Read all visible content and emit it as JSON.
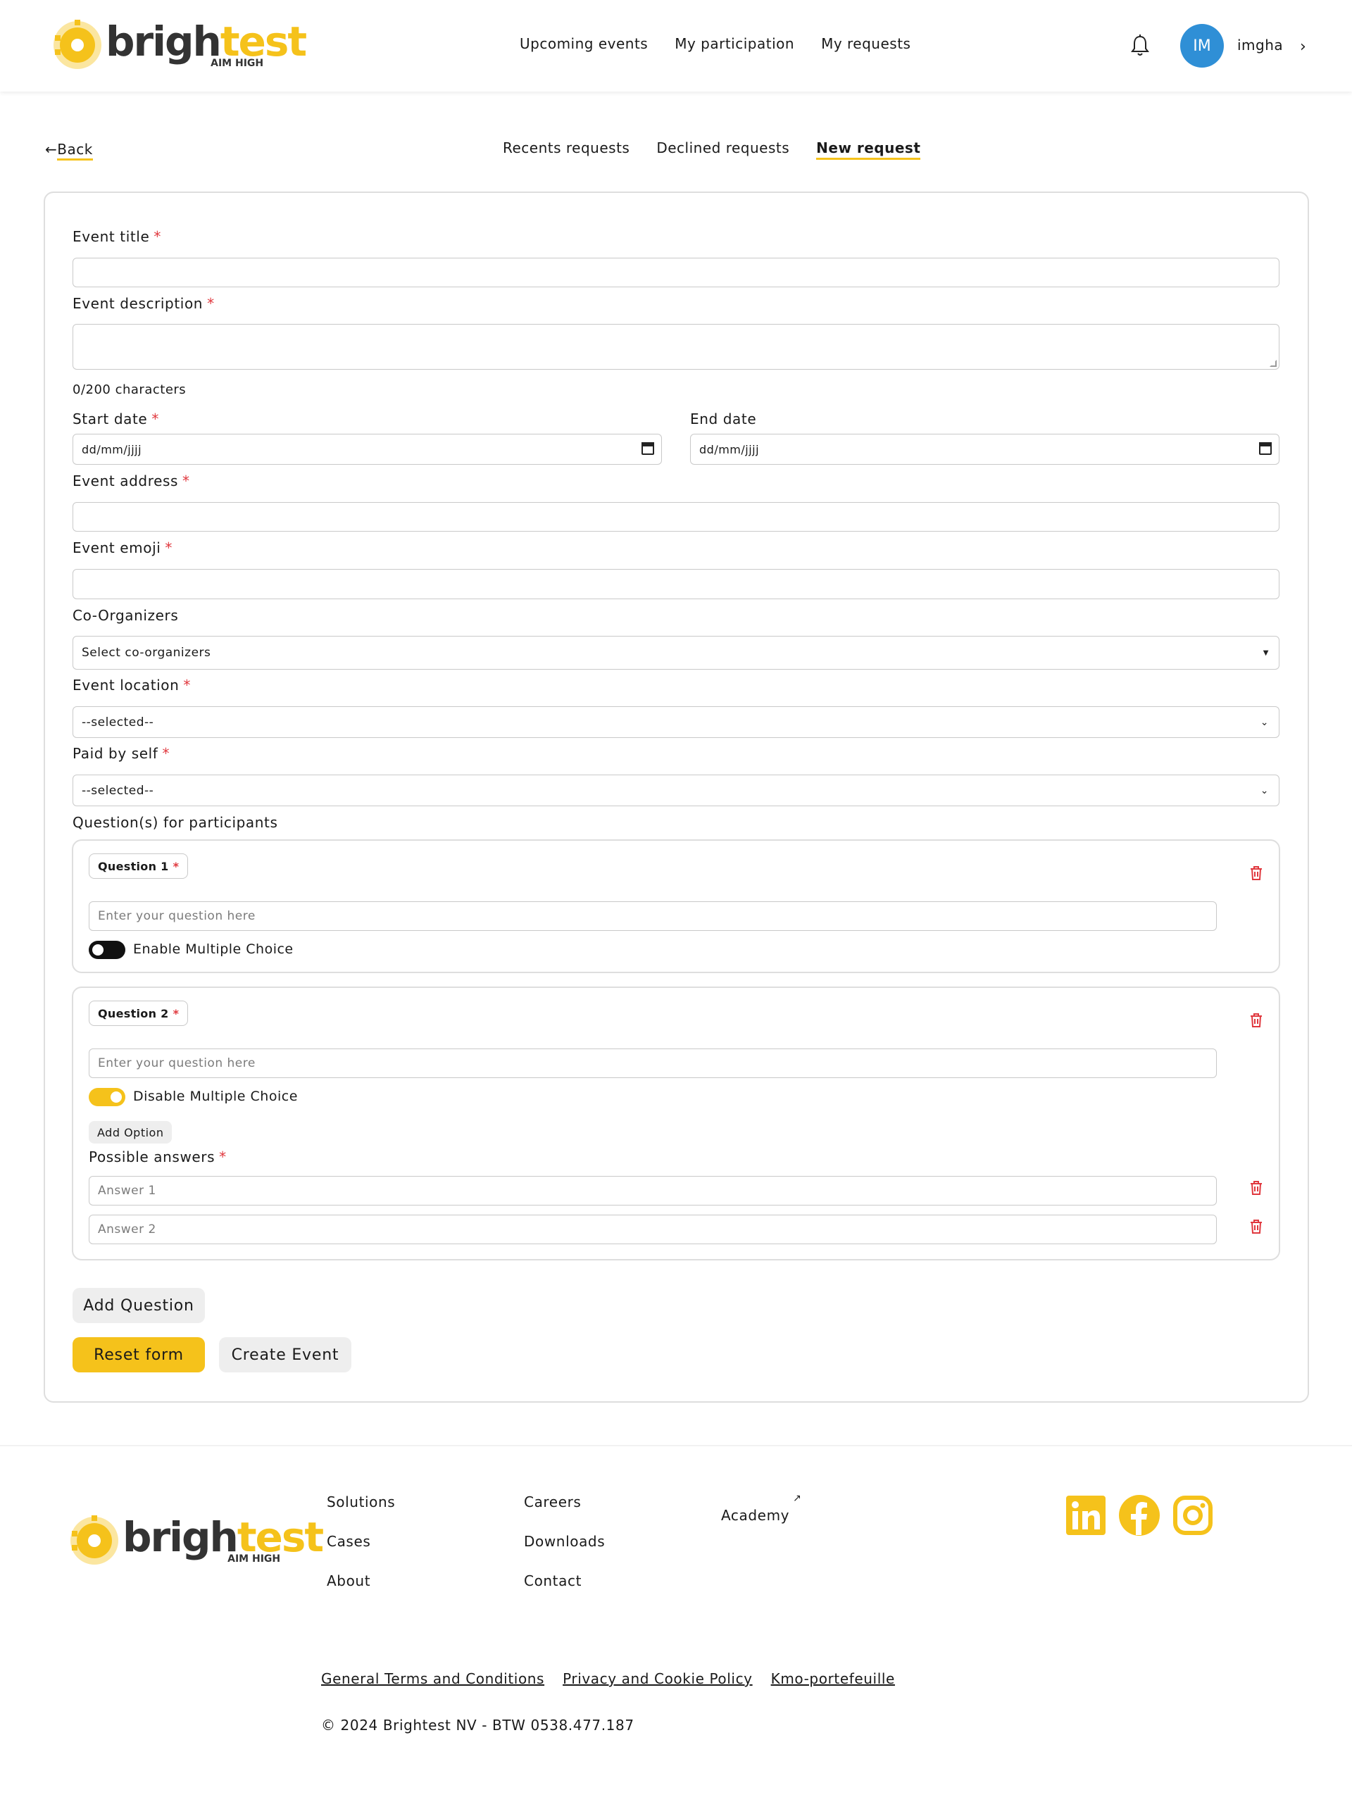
{
  "brand": {
    "name_dark": "brigh",
    "name_yellow": "test",
    "tagline": "AIM HIGH",
    "accent": "#f5c21b",
    "dark": "#333333"
  },
  "topnav": {
    "items": [
      "Upcoming events",
      "My participation",
      "My requests"
    ]
  },
  "user": {
    "initials": "IM",
    "name": "imgha",
    "avatar_color": "#2f8fd6"
  },
  "subnav": {
    "back": "Back",
    "tabs": [
      "Recents requests",
      "Declined requests",
      "New request"
    ],
    "active_tab": "New request"
  },
  "form": {
    "event_title_label": "Event title",
    "event_description_label": "Event description",
    "char_count": "0/200 characters",
    "start_date_label": "Start date",
    "start_date_placeholder": "dd/mm/jjjj",
    "end_date_label": "End date",
    "end_date_placeholder": "dd/mm/jjjj",
    "event_address_label": "Event address",
    "event_emoji_label": "Event emoji",
    "co_organizers_label": "Co-Organizers",
    "co_organizers_placeholder": "Select co-organizers",
    "event_location_label": "Event location",
    "event_location_value": "--selected--",
    "paid_by_self_label": "Paid by self",
    "paid_by_self_value": "--selected--",
    "questions_label": "Question(s) for participants",
    "questions": [
      {
        "title": "Question 1",
        "placeholder": "Enter your question here",
        "toggle_label": "Enable Multiple Choice",
        "multiple_choice": false
      },
      {
        "title": "Question 2",
        "placeholder": "Enter your question here",
        "toggle_label": "Disable Multiple Choice",
        "multiple_choice": true,
        "add_option": "Add Option",
        "answers_label": "Possible answers",
        "answers": [
          "Answer 1",
          "Answer 2"
        ]
      }
    ],
    "add_question": "Add Question",
    "reset": "Reset form",
    "create": "Create Event",
    "required_mark": "*"
  },
  "footer": {
    "col1": [
      "Solutions",
      "Cases",
      "About"
    ],
    "col2": [
      "Careers",
      "Downloads",
      "Contact"
    ],
    "academy": "Academy",
    "external_icon": "external-link-icon",
    "social": [
      "linkedin-icon",
      "facebook-icon",
      "instagram-icon"
    ],
    "legal": [
      "General Terms and Conditions",
      "Privacy and Cookie Policy",
      "Kmo-portefeuille"
    ],
    "copyright": "© 2024 Brightest NV - BTW 0538.477.187"
  }
}
